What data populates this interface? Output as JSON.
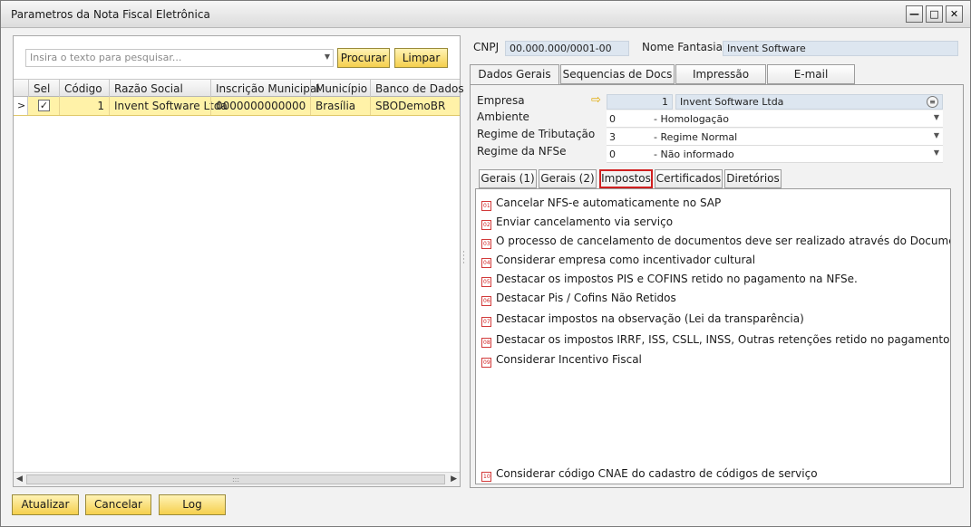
{
  "window": {
    "title": "Parametros da Nota Fiscal Eletrônica",
    "controls": {
      "minimize": "—",
      "maximize": "□",
      "close": "✕"
    }
  },
  "search": {
    "placeholder": "Insira o texto para pesquisar...",
    "search_label": "Procurar",
    "clear_label": "Limpar"
  },
  "grid": {
    "columns": [
      "Sel",
      "Código",
      "Razão Social",
      "Inscrição Municipal",
      "Município",
      "Banco de Dados"
    ],
    "rows": [
      {
        "sel": "✓",
        "codigo": "1",
        "razao_social": "Invent Software Ltda",
        "inscricao": "0000000000000",
        "municipio": "Brasília",
        "banco": "SBODemoBR"
      }
    ],
    "row_indicator": ">"
  },
  "footer": {
    "update_label": "Atualizar",
    "cancel_label": "Cancelar",
    "log_label": "Log"
  },
  "header": {
    "cnpj_label": "CNPJ",
    "cnpj_value": "00.000.000/0001-00",
    "fantasia_label": "Nome Fantasia",
    "fantasia_value": "Invent Software"
  },
  "tabs": [
    "Dados Gerais",
    "Sequencias de Docs",
    "Impressão",
    "E-mail"
  ],
  "dados_gerais": {
    "empresa_label": "Empresa",
    "empresa_code": "1",
    "empresa_name": "Invent Software Ltda",
    "ambiente_label": "Ambiente",
    "ambiente_code": "0",
    "ambiente_desc": "- Homologação",
    "regime_trib_label": "Regime de Tributação",
    "regime_trib_code": "3",
    "regime_trib_desc": "- Regime Normal",
    "regime_nfse_label": "Regime da NFSe",
    "regime_nfse_code": "0",
    "regime_nfse_desc": "- Não informado"
  },
  "subtabs": [
    "Gerais (1)",
    "Gerais (2)",
    "Impostos",
    "Certificados",
    "Diretórios"
  ],
  "impostos": {
    "options": [
      {
        "num": "01",
        "label": "Cancelar NFS-e automaticamente no SAP"
      },
      {
        "num": "02",
        "label": "Enviar cancelamento via serviço"
      },
      {
        "num": "03",
        "label": "O processo de cancelamento de documentos deve ser realizado através do Documento de Devolução"
      },
      {
        "num": "04",
        "label": "Considerar empresa como incentivador cultural"
      },
      {
        "num": "05",
        "label": "Destacar os impostos PIS e COFINS retido no pagamento na NFSe."
      },
      {
        "num": "06",
        "label": "Destacar Pis / Cofins Não Retidos"
      },
      {
        "num": "07",
        "label": "Destacar impostos na observação (Lei da transparência)"
      },
      {
        "num": "08",
        "label": "Destacar os impostos IRRF, ISS, CSLL, INSS, Outras retenções retido no pagamento na NFSe."
      },
      {
        "num": "09",
        "label": "Considerar Incentivo Fiscal"
      },
      {
        "num": "10",
        "label": "Considerar código CNAE do cadastro de códigos de serviço"
      }
    ]
  },
  "colors": {
    "accent_yellow": "#f5cf4d",
    "selected_row": "#fff2a8",
    "field_blue": "#dde6f0",
    "active_outline": "#d01f1f"
  }
}
